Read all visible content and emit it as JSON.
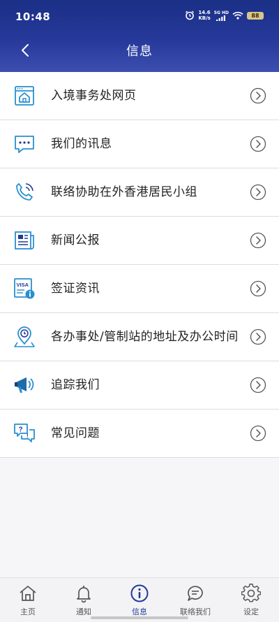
{
  "status": {
    "time": "10:48",
    "speed_value": "14.6",
    "speed_unit": "KB/s",
    "network": "5G HD",
    "battery": "88"
  },
  "header": {
    "title": "信息"
  },
  "menu": {
    "items": [
      {
        "label": "入境事务处网页",
        "icon": "browser-home-icon"
      },
      {
        "label": "我们的讯息",
        "icon": "chat-bubble-icon"
      },
      {
        "label": "联络协助在外香港居民小组",
        "icon": "phone-call-icon"
      },
      {
        "label": "新闻公报",
        "icon": "newspaper-icon"
      },
      {
        "label": "签证资讯",
        "icon": "visa-info-icon"
      },
      {
        "label": "各办事处/管制站的地址及办公时间",
        "icon": "location-clock-icon"
      },
      {
        "label": "追踪我们",
        "icon": "megaphone-icon"
      },
      {
        "label": "常见问题",
        "icon": "faq-bubbles-icon"
      }
    ]
  },
  "bottom_nav": {
    "items": [
      {
        "label": "主页",
        "icon": "home-icon"
      },
      {
        "label": "通知",
        "icon": "bell-icon"
      },
      {
        "label": "信息",
        "icon": "info-icon"
      },
      {
        "label": "联络我们",
        "icon": "contact-chat-icon"
      },
      {
        "label": "设定",
        "icon": "gear-icon"
      }
    ],
    "active_index": 2
  },
  "colors": {
    "header": "#23368f",
    "accent": "#1f3a9a",
    "icon_blue": "#2a8fd0"
  }
}
